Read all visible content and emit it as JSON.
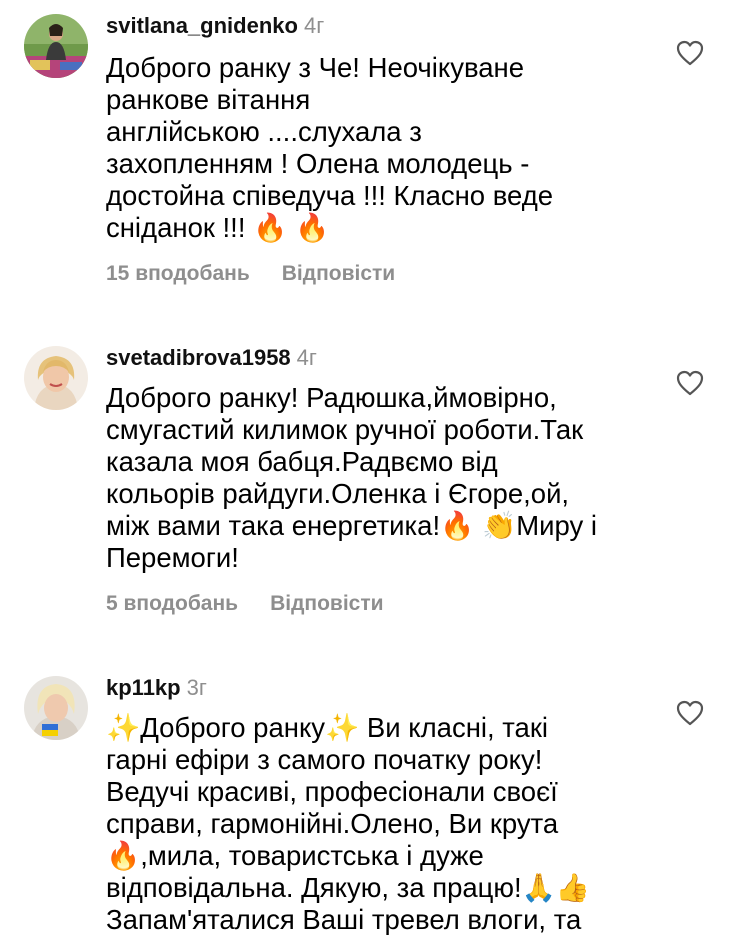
{
  "comments": [
    {
      "username": "svitlana_gnidenko",
      "time": "4г",
      "text": "Доброго ранку з Че! Неочікуване\nранкове вітання\nанглійською ....слухала з\nзахопленням ! Олена молодець -\nдостойна співедуча !!! Класно веде\nсніданок !!! 🔥 🔥",
      "likes": "15 вподобань",
      "reply": "Відповісти",
      "like_icon": "heart-outline-icon"
    },
    {
      "username": "svetadibrova1958",
      "time": "4г",
      "text": "Доброго ранку! Радюшка,ймовірно,\nсмугастий килимок ручної роботи.Так\nказала моя бабця.Радвємо від\nкольорів райдуги.Оленка і Єгоре,ой,\nміж вами така енергетика!🔥 👏Миру і\nПеремоги!",
      "likes": "5 вподобань",
      "reply": "Відповісти",
      "like_icon": "heart-outline-icon"
    },
    {
      "username": "kp11kp",
      "time": "3г",
      "text": "✨Доброго ранку✨  Ви класні, такі\nгарні ефіри з самого початку року!\nВедучі красиві, професіонали своєї\nсправи, гармонійні.Олено, Ви крута\n🔥,мила, товаристська і дуже\nвідповідальна. Дякую, за працю!🙏👍\nЗапам'яталися Ваші тревел влоги, та",
      "like_icon": "heart-outline-icon"
    }
  ]
}
